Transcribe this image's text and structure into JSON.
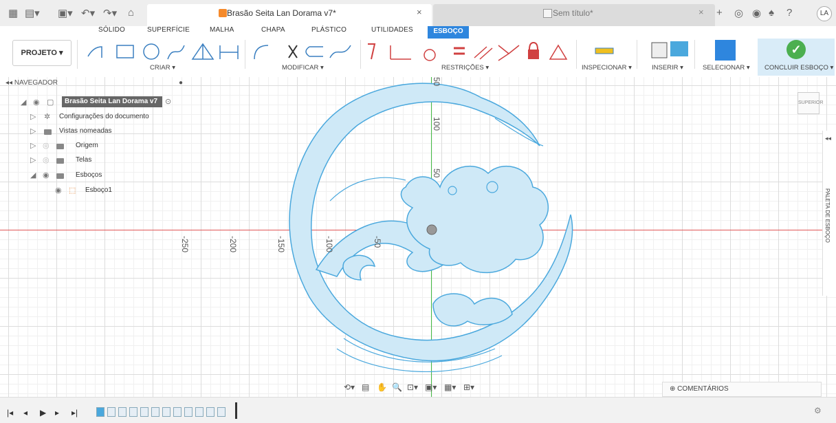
{
  "window": {
    "doc_tab_title": "Brasão Seita Lan Dorama v7*",
    "doc_tab_close": "×",
    "second_tab_title": "Sem título*",
    "second_tab_close": "×",
    "user_initials": "LA"
  },
  "ribbon": {
    "tabs": [
      "SÓLIDO",
      "SUPERFÍCIE",
      "MALHA",
      "CHAPA",
      "PLÁSTICO",
      "UTILIDADES",
      "ESBOÇO"
    ],
    "active_tab": "ESBOÇO",
    "projeto_label": "PROJETO ▾",
    "groups": {
      "criar": "CRIAR ▾",
      "modificar": "MODIFICAR ▾",
      "restricoes": "RESTRIÇÕES ▾",
      "inspecionar": "INSPECIONAR ▾",
      "inserir": "INSERIR ▾",
      "selecionar": "SELECIONAR ▾",
      "concluir": "CONCLUIR ESBOÇO ▾"
    }
  },
  "navigator": {
    "header": "NAVEGADOR",
    "root": "Brasão Seita Lan Dorama v7",
    "items": [
      "Configurações do documento",
      "Vistas nomeadas",
      "Origem",
      "Telas",
      "Esboços"
    ],
    "sketch": "Esboço1"
  },
  "canvas": {
    "axis_labels_x": [
      "-250",
      "-200",
      "-150",
      "-100",
      "-50"
    ],
    "axis_labels_y": [
      "50",
      "100",
      "50"
    ],
    "viewcube_label": "SUPERIOR",
    "palette_label": "PALETA DE ESBOÇO"
  },
  "comments": {
    "label": "COMENTÁRIOS"
  },
  "colors": {
    "accent": "#2e86de",
    "sketch_fill": "#cfe9f7",
    "sketch_stroke": "#4aa8dd",
    "axis_x": "#e05555",
    "axis_y": "#44bb44"
  }
}
